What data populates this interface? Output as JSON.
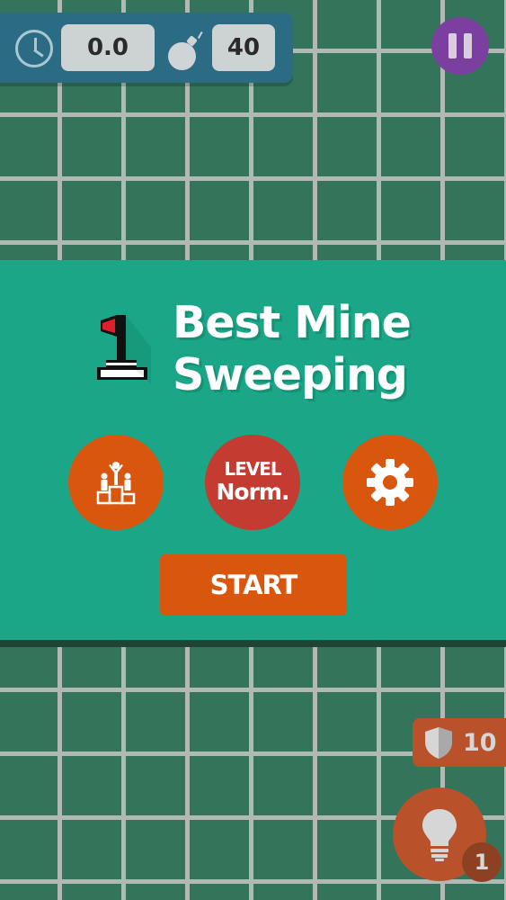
{
  "hud": {
    "time": "0.0",
    "mines": "40",
    "clock_icon": "clock-icon",
    "mine_icon": "bomb-icon",
    "pause_icon": "pause-icon"
  },
  "menu": {
    "title_line1": "Best Mine",
    "title_line2": "Sweeping",
    "level_label": "LEVEL",
    "level_value": "Norm.",
    "start_label": "START",
    "leaderboard_icon": "podium-icon",
    "settings_icon": "gear-icon"
  },
  "powerups": {
    "shield_count": "10",
    "hint_count": "1",
    "shield_icon": "shield-icon",
    "hint_icon": "lightbulb-icon"
  },
  "colors": {
    "panel": "#1aa687",
    "board": "#377b5f",
    "hud": "#2b6c84",
    "orange": "#d9560f",
    "red": "#c43b32",
    "pause": "#7b3fa0"
  }
}
